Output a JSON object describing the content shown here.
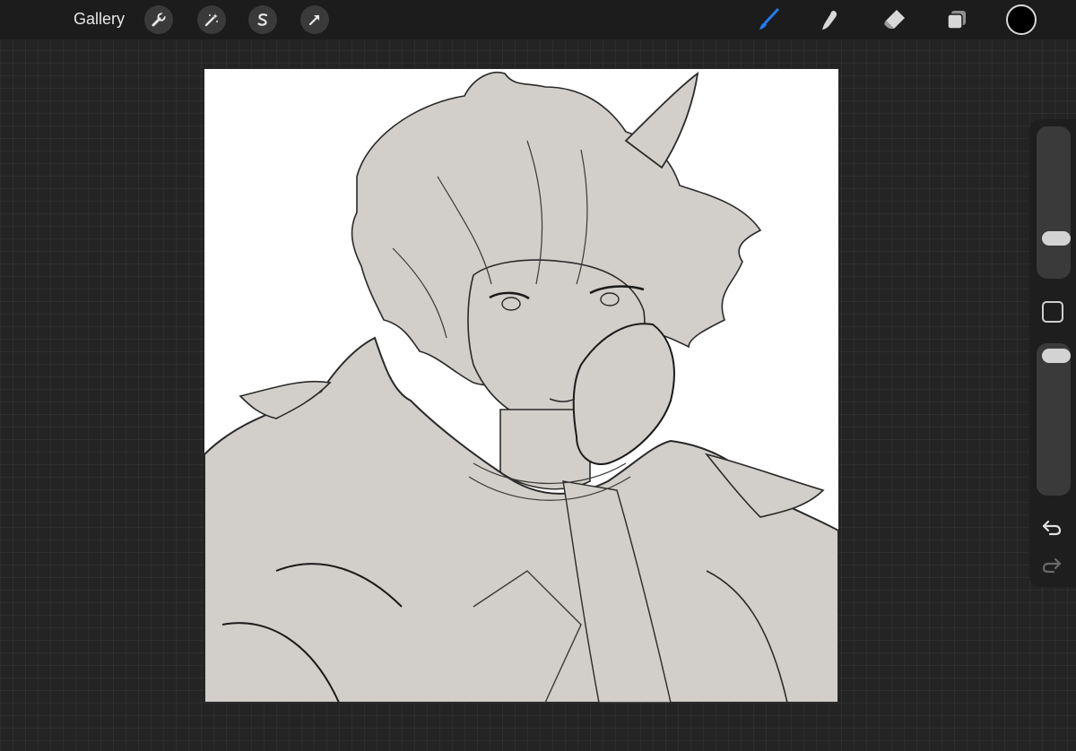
{
  "topbar": {
    "gallery_label": "Gallery",
    "left_tools": [
      {
        "name": "actions",
        "icon": "wrench-icon"
      },
      {
        "name": "adjustments",
        "icon": "magic-wand-icon"
      },
      {
        "name": "selection",
        "icon": "selection-s-icon"
      },
      {
        "name": "transform",
        "icon": "arrow-cursor-icon"
      }
    ],
    "right_tools": [
      {
        "name": "brush",
        "icon": "brush-icon",
        "active": true
      },
      {
        "name": "smudge",
        "icon": "smudge-finger-icon",
        "active": false
      },
      {
        "name": "eraser",
        "icon": "eraser-icon",
        "active": false
      },
      {
        "name": "layers",
        "icon": "layers-icon",
        "active": false
      }
    ],
    "current_color": "#000000",
    "active_tool_color": "#1f7ef5"
  },
  "sidebar": {
    "brush_size": 0.3,
    "brush_opacity": 1.0,
    "modify_icon": "square-modify-icon",
    "undo_icon": "undo-arrow-icon",
    "redo_icon": "redo-arrow-icon"
  },
  "canvas": {
    "background": "#ffffff",
    "sketch_fill": "#d2ceca",
    "line_color": "#1a1a1a"
  }
}
